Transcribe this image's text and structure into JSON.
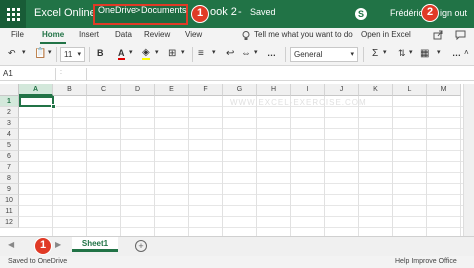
{
  "titlebar": {
    "app_name": "Excel Online",
    "breadcrumb": [
      "OneDrive",
      "Documents"
    ],
    "breadcrumb_sep": ">",
    "doc_name": "ook 2",
    "doc_sep": "-",
    "status": "Saved",
    "user": "Frédéric",
    "sign_out": "ign out"
  },
  "callouts": [
    "1",
    "2",
    "1"
  ],
  "tabs": [
    {
      "label": "File"
    },
    {
      "label": "Home",
      "active": true
    },
    {
      "label": "Insert"
    },
    {
      "label": "Data"
    },
    {
      "label": "Review"
    },
    {
      "label": "View"
    },
    {
      "label": "Tell me what you want to do"
    },
    {
      "label": "Open in Excel"
    }
  ],
  "toolbar": {
    "font_size": "11",
    "number_format": "General",
    "bold": "B",
    "font_color": "A"
  },
  "formula_bar": {
    "name_box": "A1",
    "fx_divider": ":"
  },
  "grid": {
    "columns": [
      "A",
      "B",
      "C",
      "D",
      "E",
      "F",
      "G",
      "H",
      "I",
      "J",
      "K",
      "L",
      "M"
    ],
    "rows": [
      "1",
      "2",
      "3",
      "4",
      "5",
      "6",
      "7",
      "8",
      "9",
      "10",
      "11",
      "12"
    ],
    "selected_cell": "A1",
    "watermark": "WWW.EXCEL-EXERCISE.COM"
  },
  "sheets": {
    "tabs": [
      "Sheet1"
    ],
    "add": "+"
  },
  "statusbar": {
    "left": "Saved to OneDrive",
    "right": "Help Improve Office"
  },
  "colors": {
    "brand": "#217346",
    "callout": "#e03a26"
  }
}
